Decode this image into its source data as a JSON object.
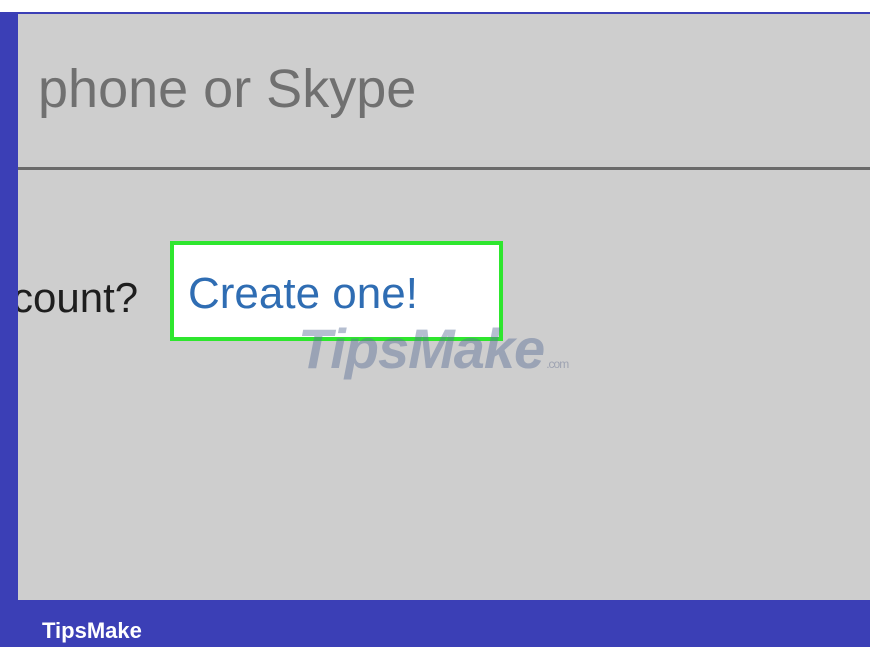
{
  "signin": {
    "field_text": "phone or Skype",
    "prompt_text": "count?",
    "create_link": "Create one!"
  },
  "watermark": {
    "brand": "TipsMake",
    "suffix": ".com"
  },
  "footer": {
    "brand_label": "TipsMake"
  },
  "colors": {
    "frame": "#3b3fb6",
    "screen_bg": "#cecece",
    "highlight": "#2ee62e",
    "link": "#2f6db3"
  }
}
